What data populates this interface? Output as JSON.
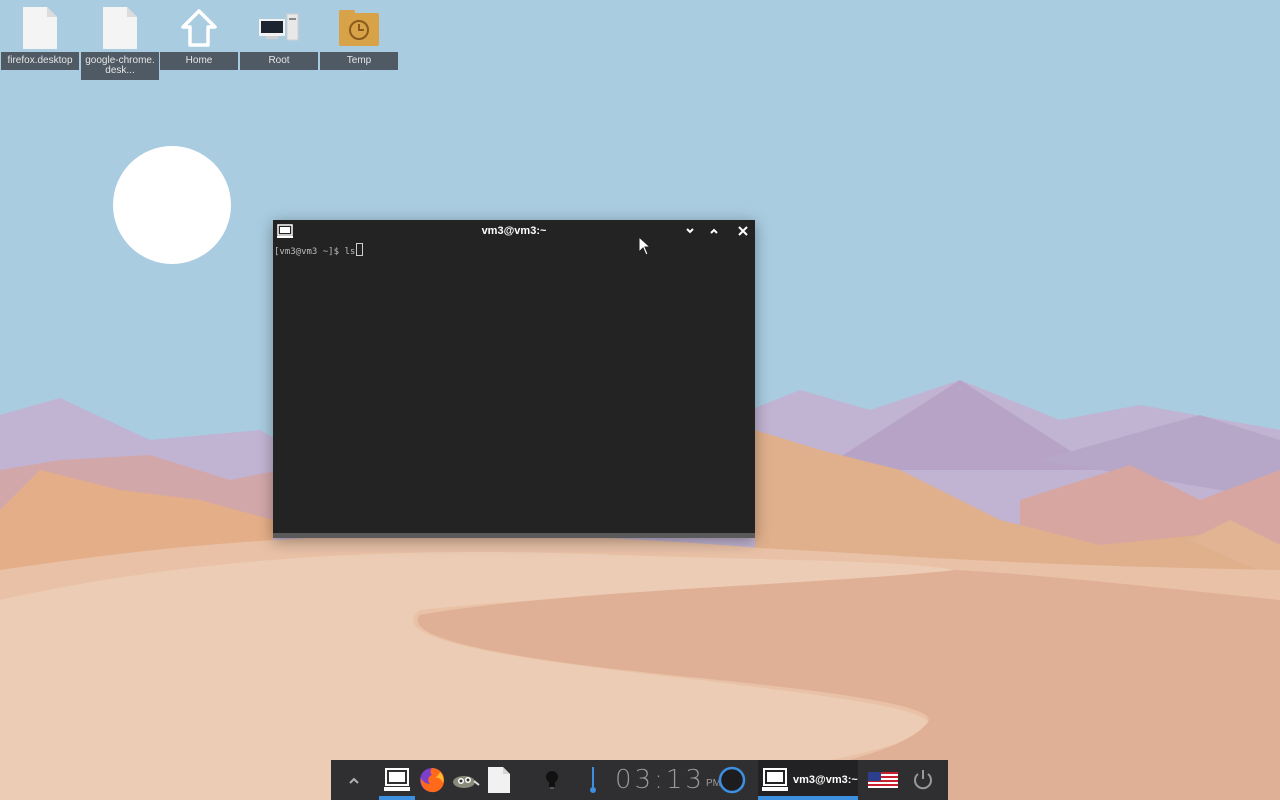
{
  "desktop": {
    "icons": [
      {
        "label": "firefox.desktop",
        "icon": "file-icon"
      },
      {
        "label": "google-chrome.desk...",
        "icon": "file-icon"
      },
      {
        "label": "Home",
        "icon": "home-icon"
      },
      {
        "label": "Root",
        "icon": "computer-icon"
      },
      {
        "label": "Temp",
        "icon": "folder-clock-icon"
      }
    ]
  },
  "terminal": {
    "title": "vm3@vm3:~",
    "prompt": "[vm3@vm3 ~]$ ",
    "command": "ls"
  },
  "taskbar": {
    "clock_time": "03:13",
    "clock_ampm": "PM",
    "active_task_label": "vm3@vm3:~",
    "launchers": [
      "chevron-up-icon",
      "terminal-icon",
      "firefox-icon",
      "file-manager-icon",
      "text-editor-icon"
    ],
    "tray": [
      "lightbulb-icon",
      "thermometer-icon",
      "circle-status-icon",
      "us-flag-icon",
      "power-icon"
    ]
  },
  "colors": {
    "sky": "#a9cce0",
    "window_bg": "#232323",
    "taskbar_bg": "#2f2f31",
    "accent": "#3d8fe0"
  }
}
